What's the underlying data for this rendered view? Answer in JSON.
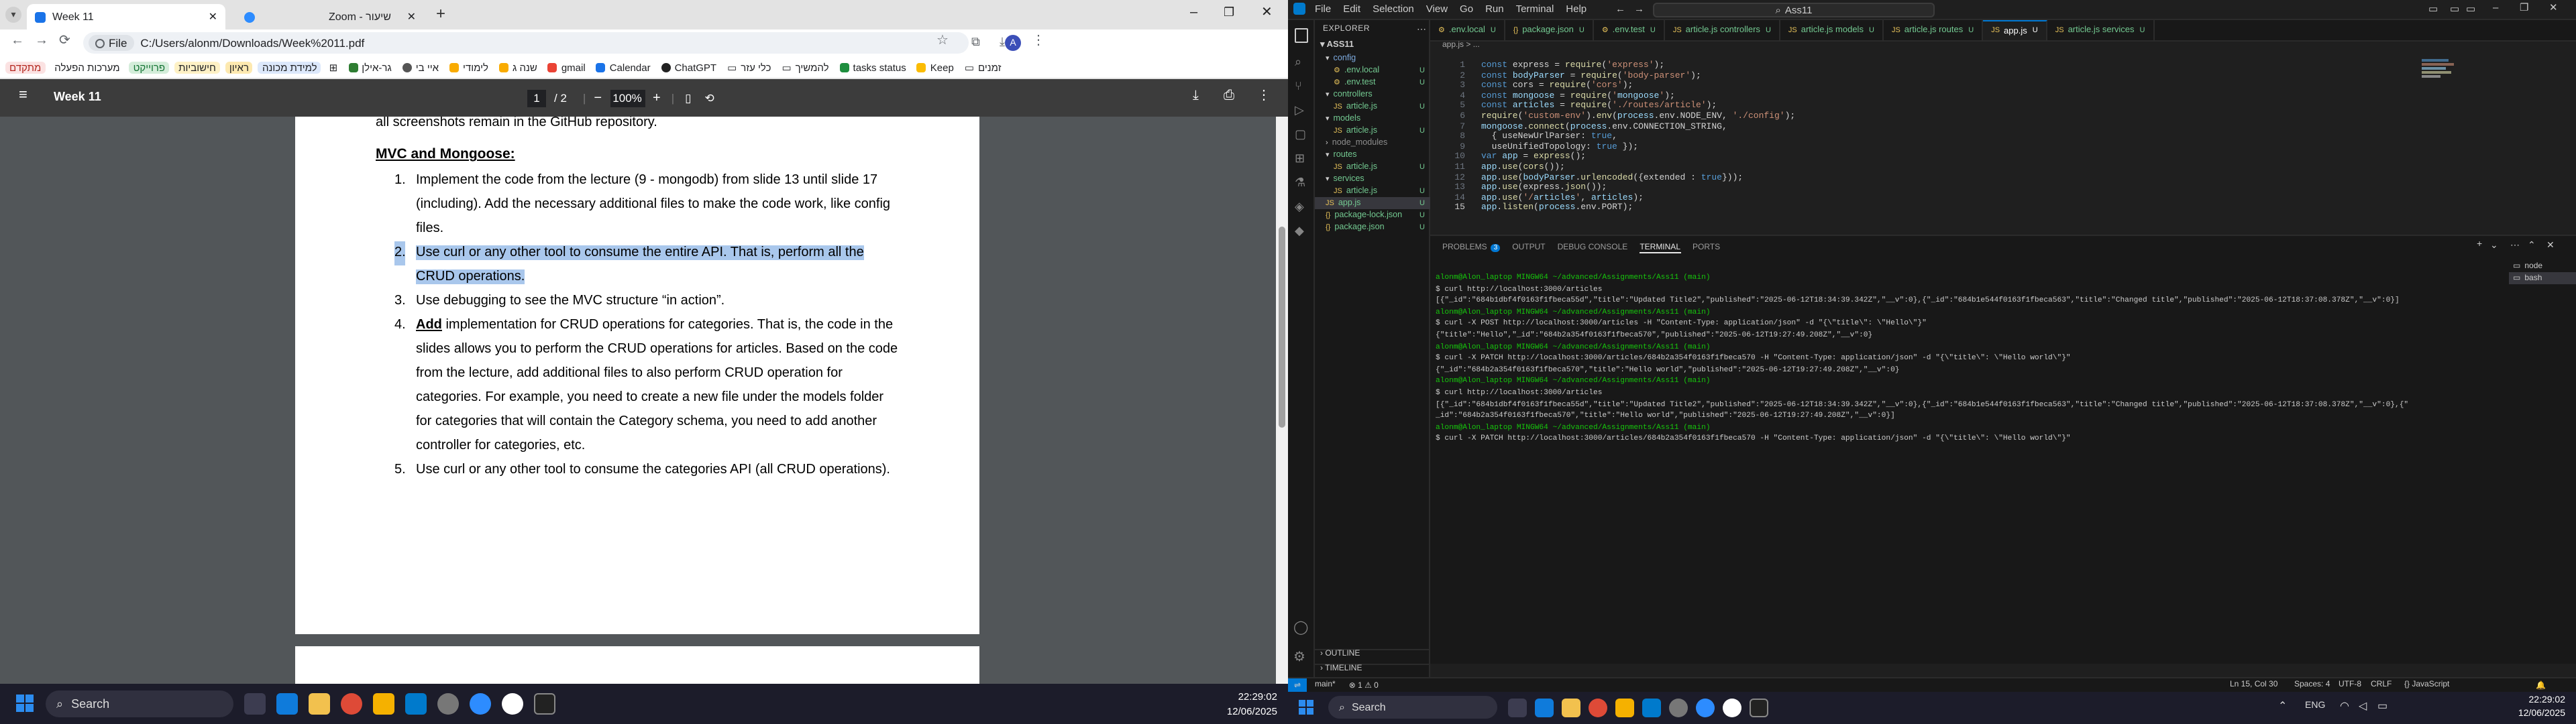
{
  "chrome": {
    "tabs": [
      {
        "title": "Week 11",
        "active": true
      },
      {
        "title": "Zoom - שיעור",
        "active": false
      }
    ],
    "file_chip": "File",
    "url": "C:/Users/alonm/Downloads/Week%2011.pdf",
    "profile_initial": "A",
    "bookmarks": [
      "מתקדם",
      "מערכות הפעלה",
      "פרוייקט",
      "חישוביות",
      "ראיון",
      "למידת מכונה",
      "גר-אילן",
      "איי בי",
      "לימודי",
      "שנה ג",
      "gmail",
      "Calendar",
      "ChatGPT",
      "כלי עזר",
      "להמשיך",
      "tasks status",
      "Keep",
      "זמנים"
    ],
    "bookmark_colors": [
      "#d93025",
      "#1e8e3e",
      "#1e8e3e",
      "#f9ab00",
      "#f9ab00",
      "#1a73e8"
    ]
  },
  "pdf": {
    "title": "Week 11",
    "page_current": "1",
    "page_total": "/ 2",
    "zoom": "100%",
    "top_line": "all screenshots remain in the GitHub repository.",
    "heading": "MVC and Mongoose:",
    "items": [
      {
        "num": "1.",
        "lines": [
          "Implement the code from the lecture (9 - mongodb) from slide 13 until slide 17",
          "(including). Add the necessary additional files to make the code work, like config",
          "files."
        ]
      },
      {
        "num": "2.",
        "lines": [
          "Use curl or any other tool to consume the entire API. That is, perform all the",
          "CRUD operations."
        ],
        "highlighted": true
      },
      {
        "num": "3.",
        "lines": [
          "Use debugging to see the MVC structure “in action”."
        ]
      },
      {
        "num": "4.",
        "underline_word": "Add",
        "lines": [
          " implementation for CRUD operations for categories. That is, the code in the",
          "slides allows you to perform the CRUD operations for articles. Based on the code",
          "from the lecture, add additional files to also perform CRUD operation for",
          "categories. For example, you need to create a new file under the models folder",
          "for categories that will contain the Category schema, you need to add another",
          "controller for categories, etc."
        ]
      },
      {
        "num": "5.",
        "lines": [
          "Use curl or any other tool to consume the categories API (all CRUD operations)."
        ]
      }
    ]
  },
  "taskbar1": {
    "search": "Search",
    "time": "22:29:02",
    "date": "12/06/2025"
  },
  "vscode": {
    "menu": [
      "File",
      "Edit",
      "Selection",
      "View",
      "Go",
      "Run",
      "Terminal",
      "Help"
    ],
    "search": "Ass11",
    "explorer_label": "EXPLORER",
    "project": "ASS11",
    "tree": [
      {
        "label": "config",
        "indent": 1,
        "folder": true,
        "color": "#7ca9dd"
      },
      {
        "label": ".env.local",
        "indent": 2,
        "badge": "U",
        "color": "#73c991"
      },
      {
        "label": ".env.test",
        "indent": 2,
        "badge": "U",
        "color": "#73c991"
      },
      {
        "label": "controllers",
        "indent": 1,
        "folder": true,
        "color": "#73c991"
      },
      {
        "label": "article.js",
        "indent": 2,
        "badge": "U",
        "color": "#73c991"
      },
      {
        "label": "models",
        "indent": 1,
        "folder": true,
        "color": "#73c991"
      },
      {
        "label": "article.js",
        "indent": 2,
        "badge": "U",
        "color": "#73c991"
      },
      {
        "label": "node_modules",
        "indent": 1,
        "folder": true,
        "color": "#8c8c8c"
      },
      {
        "label": "routes",
        "indent": 1,
        "folder": true,
        "color": "#73c991"
      },
      {
        "label": "article.js",
        "indent": 2,
        "badge": "U",
        "color": "#73c991"
      },
      {
        "label": "services",
        "indent": 1,
        "folder": true,
        "color": "#73c991"
      },
      {
        "label": "article.js",
        "indent": 2,
        "badge": "U",
        "color": "#73c991"
      },
      {
        "label": "app.js",
        "indent": 1,
        "badge": "U",
        "color": "#73c991",
        "selected": true
      },
      {
        "label": "package-lock.json",
        "indent": 1,
        "badge": "U",
        "color": "#73c991"
      },
      {
        "label": "package.json",
        "indent": 1,
        "badge": "U",
        "color": "#73c991"
      }
    ],
    "editor_tabs": [
      {
        "label": ".env.local",
        "badge": "U"
      },
      {
        "label": "package.json",
        "badge": "U"
      },
      {
        "label": ".env.test",
        "badge": "U"
      },
      {
        "label": "article.js controllers",
        "badge": "U"
      },
      {
        "label": "article.js models",
        "badge": "U"
      },
      {
        "label": "article.js routes",
        "badge": "U"
      },
      {
        "label": "app.js",
        "badge": "U",
        "active": true
      },
      {
        "label": "article.js services",
        "badge": "U"
      }
    ],
    "breadcrumb": "app.js > ...",
    "code_lines": [
      "const express = require('express');",
      "const bodyParser = require('body-parser');",
      "const cors = require('cors');",
      "const mongoose = require('mongoose');",
      "const articles = require('./routes/article');",
      "require('custom-env').env(process.env.NODE_ENV, './config');",
      "mongoose.connect(process.env.CONNECTION_STRING,",
      "  { useNewUrlParser: true,",
      "  useUnifiedTopology: true });",
      "var app = express();",
      "app.use(cors());",
      "app.use(bodyParser.urlencoded({extended : true}));",
      "app.use(express.json());",
      "app.use('/articles', articles);",
      "app.listen(process.env.PORT);"
    ],
    "panel_tabs": [
      "PROBLEMS",
      "OUTPUT",
      "DEBUG CONSOLE",
      "TERMINAL",
      "PORTS"
    ],
    "problems_count": "3",
    "terminal": [
      {
        "prompt": "alonm@Alon_laptop MINGW64 ~/advanced/Assignments/Ass11 (main)"
      },
      {
        "text": "$ curl http://localhost:3000/articles"
      },
      {
        "text": "[{\"_id\":\"684b1dbf4f0163f1fbeca55d\",\"title\":\"Updated Title2\",\"published\":\"2025-06-12T18:34:39.342Z\",\"__v\":0},{\"_id\":\"684b1e544f0163f1fbeca563\",\"title\":\"Changed title\",\"published\":\"2025-06-12T18:37:08.378Z\",\"__v\":0}]"
      },
      {
        "prompt": "alonm@Alon_laptop MINGW64 ~/advanced/Assignments/Ass11 (main)"
      },
      {
        "text": "$ curl -X POST http://localhost:3000/articles -H \"Content-Type: application/json\" -d \"{\\\"title\\\": \\\"Hello\\\"}\""
      },
      {
        "text": "{\"title\":\"Hello\",\"_id\":\"684b2a354f0163f1fbeca570\",\"published\":\"2025-06-12T19:27:49.208Z\",\"__v\":0}"
      },
      {
        "prompt": "alonm@Alon_laptop MINGW64 ~/advanced/Assignments/Ass11 (main)"
      },
      {
        "text": "$ curl -X PATCH http://localhost:3000/articles/684b2a354f0163f1fbeca570 -H \"Content-Type: application/json\" -d \"{\\\"title\\\": \\\"Hello world\\\"}\""
      },
      {
        "text": "{\"_id\":\"684b2a354f0163f1fbeca570\",\"title\":\"Hello world\",\"published\":\"2025-06-12T19:27:49.208Z\",\"__v\":0}"
      },
      {
        "prompt": "alonm@Alon_laptop MINGW64 ~/advanced/Assignments/Ass11 (main)"
      },
      {
        "text": "$ curl http://localhost:3000/articles"
      },
      {
        "text": "[{\"_id\":\"684b1dbf4f0163f1fbeca55d\",\"title\":\"Updated Title2\",\"published\":\"2025-06-12T18:34:39.342Z\",\"__v\":0},{\"_id\":\"684b1e544f0163f1fbeca563\",\"title\":\"Changed title\",\"published\":\"2025-06-12T18:37:08.378Z\",\"__v\":0},{\""
      },
      {
        "text": "_id\":\"684b2a354f0163f1fbeca570\",\"title\":\"Hello world\",\"published\":\"2025-06-12T19:27:49.208Z\",\"__v\":0}]"
      },
      {
        "prompt": "alonm@Alon_laptop MINGW64 ~/advanced/Assignments/Ass11 (main)"
      },
      {
        "text": "$ curl -X PATCH http://localhost:3000/articles/684b2a354f0163f1fbeca570 -H \"Content-Type: application/json\" -d \"{\\\"title\\\": \\\"Hello world\\\"}\""
      }
    ],
    "shells": [
      "node",
      "bash"
    ],
    "outline": "OUTLINE",
    "timeline": "TIMELINE",
    "status_left": [
      "main*",
      "⊗ 1 ⚠ 0"
    ],
    "status_right": [
      "Ln 15, Col 30",
      "Spaces: 4",
      "UTF-8",
      "CRLF",
      "{} JavaScript"
    ]
  },
  "taskbar2": {
    "search": "Search",
    "time": "22:29:02",
    "lang": "ENG",
    "date": "12/06/2025"
  }
}
